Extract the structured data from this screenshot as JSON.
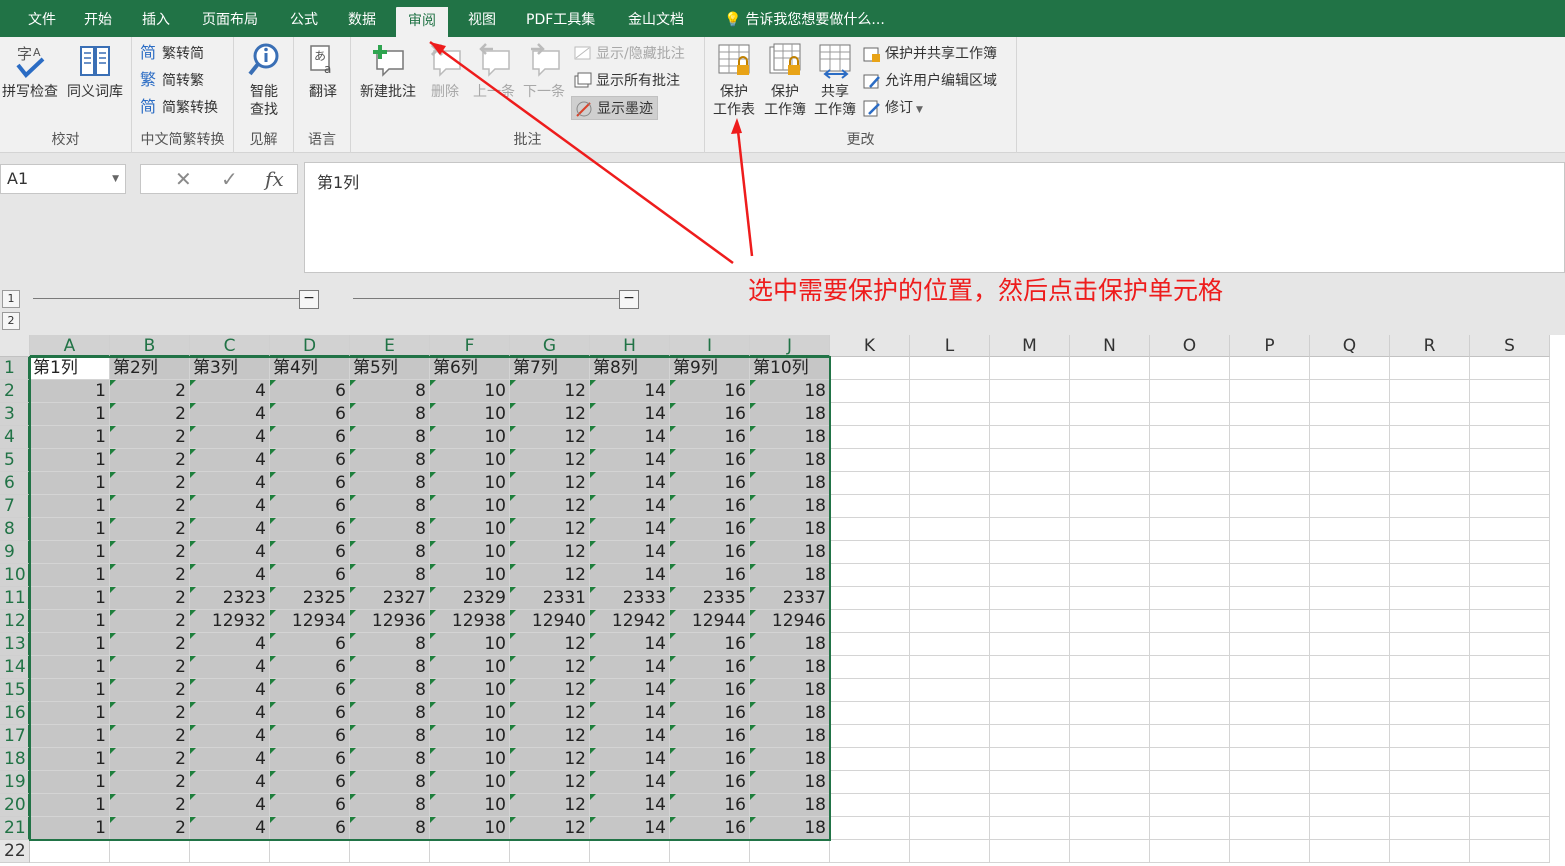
{
  "tabs": [
    "文件",
    "开始",
    "插入",
    "页面布局",
    "公式",
    "数据",
    "审阅",
    "视图",
    "PDF工具集",
    "金山文档"
  ],
  "active_tab": "审阅",
  "tell_me": "告诉我您想要做什么...",
  "ribbon": {
    "proof": {
      "spell": "拼写检查",
      "thesaurus": "同义词库",
      "label": "校对"
    },
    "chinese": {
      "to_trad": "繁转简",
      "to_simp": "简转繁",
      "convert": "简繁转换",
      "label": "中文简繁转换"
    },
    "insights": {
      "smart_lookup_1": "智能",
      "smart_lookup_2": "查找",
      "label": "见解"
    },
    "language": {
      "translate": "翻译",
      "label": "语言"
    },
    "comments": {
      "new": "新建批注",
      "delete": "删除",
      "prev": "上一条",
      "next": "下一条",
      "show_hide": "显示/隐藏批注",
      "show_all": "显示所有批注",
      "show_ink": "显示墨迹",
      "label": "批注"
    },
    "changes": {
      "protect_sheet_1": "保护",
      "protect_sheet_2": "工作表",
      "protect_wb_1": "保护",
      "protect_wb_2": "工作簿",
      "share_1": "共享",
      "share_2": "工作簿",
      "protect_share": "保护并共享工作簿",
      "allow_edit": "允许用户编辑区域",
      "track": "修订",
      "label": "更改"
    }
  },
  "name_box": "A1",
  "formula": "第1列",
  "outline_levels": [
    "1",
    "2"
  ],
  "columns": [
    "A",
    "B",
    "C",
    "D",
    "E",
    "F",
    "G",
    "H",
    "I",
    "J",
    "K",
    "L",
    "M",
    "N",
    "O",
    "P",
    "Q",
    "R",
    "S"
  ],
  "rows": [
    [
      "第1列",
      "第2列",
      "第3列",
      "第4列",
      "第5列",
      "第6列",
      "第7列",
      "第8列",
      "第9列",
      "第10列"
    ],
    [
      "1",
      "2",
      "4",
      "6",
      "8",
      "10",
      "12",
      "14",
      "16",
      "18"
    ],
    [
      "1",
      "2",
      "4",
      "6",
      "8",
      "10",
      "12",
      "14",
      "16",
      "18"
    ],
    [
      "1",
      "2",
      "4",
      "6",
      "8",
      "10",
      "12",
      "14",
      "16",
      "18"
    ],
    [
      "1",
      "2",
      "4",
      "6",
      "8",
      "10",
      "12",
      "14",
      "16",
      "18"
    ],
    [
      "1",
      "2",
      "4",
      "6",
      "8",
      "10",
      "12",
      "14",
      "16",
      "18"
    ],
    [
      "1",
      "2",
      "4",
      "6",
      "8",
      "10",
      "12",
      "14",
      "16",
      "18"
    ],
    [
      "1",
      "2",
      "4",
      "6",
      "8",
      "10",
      "12",
      "14",
      "16",
      "18"
    ],
    [
      "1",
      "2",
      "4",
      "6",
      "8",
      "10",
      "12",
      "14",
      "16",
      "18"
    ],
    [
      "1",
      "2",
      "4",
      "6",
      "8",
      "10",
      "12",
      "14",
      "16",
      "18"
    ],
    [
      "1",
      "2",
      "2323",
      "2325",
      "2327",
      "2329",
      "2331",
      "2333",
      "2335",
      "2337"
    ],
    [
      "1",
      "2",
      "12932",
      "12934",
      "12936",
      "12938",
      "12940",
      "12942",
      "12944",
      "12946"
    ],
    [
      "1",
      "2",
      "4",
      "6",
      "8",
      "10",
      "12",
      "14",
      "16",
      "18"
    ],
    [
      "1",
      "2",
      "4",
      "6",
      "8",
      "10",
      "12",
      "14",
      "16",
      "18"
    ],
    [
      "1",
      "2",
      "4",
      "6",
      "8",
      "10",
      "12",
      "14",
      "16",
      "18"
    ],
    [
      "1",
      "2",
      "4",
      "6",
      "8",
      "10",
      "12",
      "14",
      "16",
      "18"
    ],
    [
      "1",
      "2",
      "4",
      "6",
      "8",
      "10",
      "12",
      "14",
      "16",
      "18"
    ],
    [
      "1",
      "2",
      "4",
      "6",
      "8",
      "10",
      "12",
      "14",
      "16",
      "18"
    ],
    [
      "1",
      "2",
      "4",
      "6",
      "8",
      "10",
      "12",
      "14",
      "16",
      "18"
    ],
    [
      "1",
      "2",
      "4",
      "6",
      "8",
      "10",
      "12",
      "14",
      "16",
      "18"
    ],
    [
      "1",
      "2",
      "4",
      "6",
      "8",
      "10",
      "12",
      "14",
      "16",
      "18"
    ],
    [
      "",
      "",
      "",
      "",
      "",
      "",
      "",
      "",
      "",
      ""
    ]
  ],
  "annotation": "选中需要保护的位置，然后点击保护单元格",
  "colors": {
    "excel_green": "#217346",
    "annotation_red": "#ee1c1c",
    "selection_gray": "#c6c6c6"
  }
}
